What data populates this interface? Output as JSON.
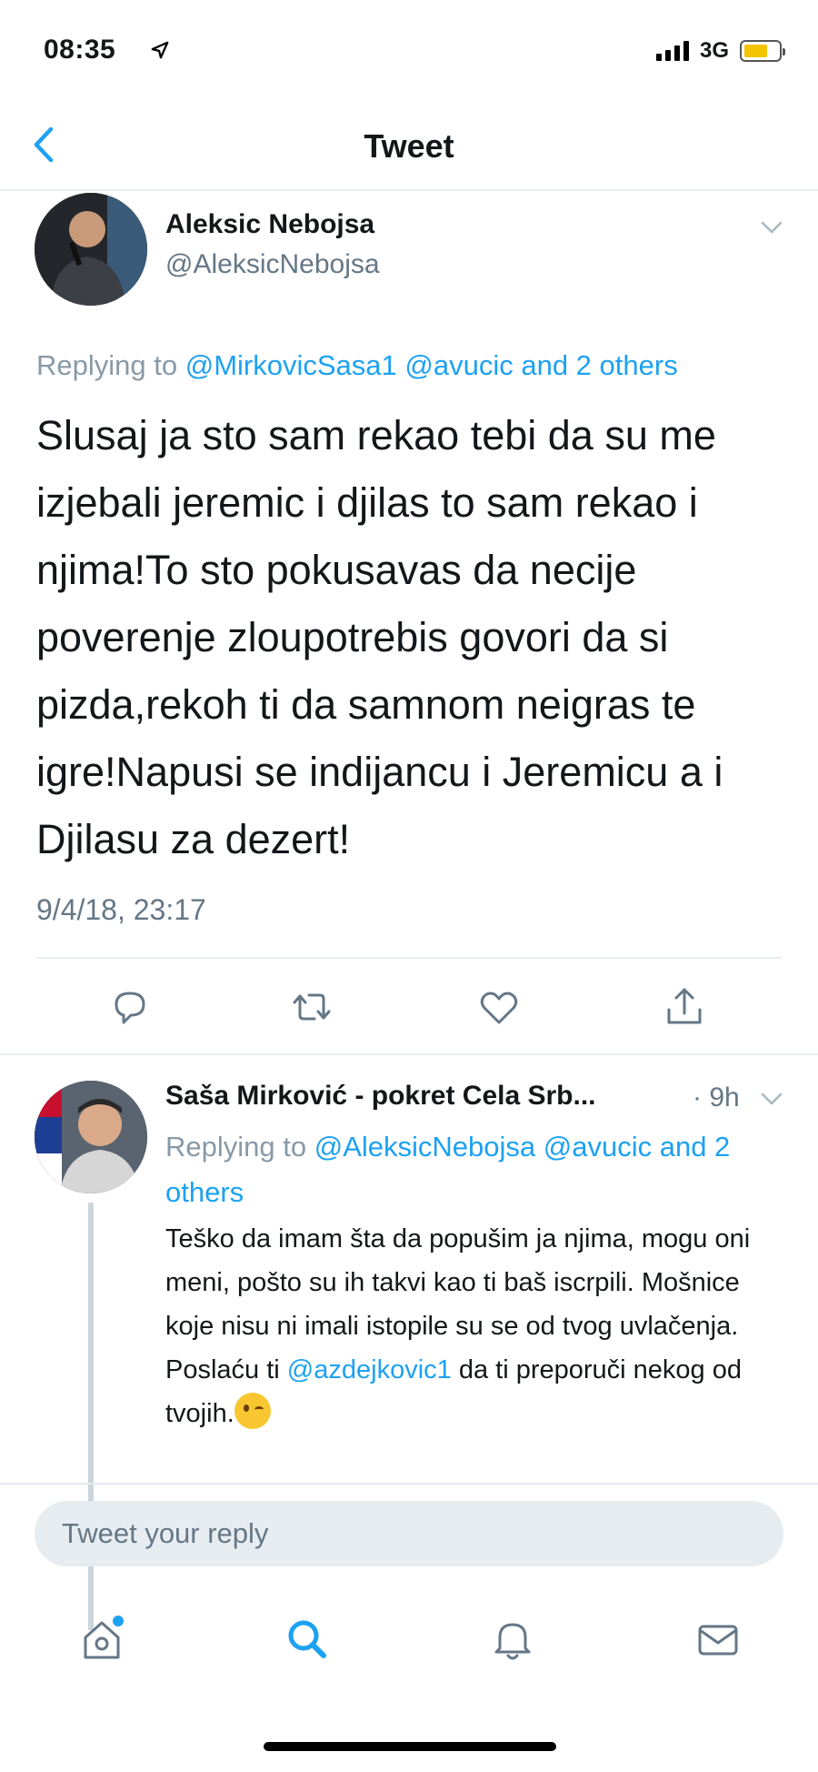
{
  "status_bar": {
    "time": "08:35",
    "network": "3G",
    "battery_level": 0.7,
    "battery_color": "#f5c400"
  },
  "nav": {
    "title": "Tweet",
    "back_icon": "chevron-left-icon"
  },
  "main_tweet": {
    "author_name": "Aleksic Nebojsa",
    "author_handle": "@AleksicNebojsa",
    "replying_prefix": "Replying to",
    "replying_mention_1": "@MirkovicSasa1",
    "replying_mention_2": "@avucic",
    "replying_suffix": "and 2 others",
    "text": "Slusaj ja sto sam rekao tebi da su me izjebali jeremic i djilas to sam rekao i njima!To sto pokusavas da necije poverenje zloupotrebis govori da si pizda,rekoh ti da samnom neigras te igre!Napusi se indijancu i Jeremicu a i Djilasu za dezert!",
    "timestamp": "9/4/18, 23:17",
    "actions": [
      "reply-icon",
      "retweet-icon",
      "like-icon",
      "share-icon"
    ]
  },
  "reply_tweet": {
    "author_name": "Saša Mirković - pokret Cela Srb...",
    "time_ago": "· 9h",
    "replying_prefix": "Replying to",
    "replying_mention_1": "@AleksicNebojsa",
    "replying_mention_2": "@avucic",
    "replying_suffix": "and 2 others",
    "text_part1": "Teško da imam šta da popušim ja njima, mogu oni meni, pošto su ih takvi kao ti baš iscrpili. Mošnice koje nisu ni imali istopile su se od tvog uvlačenja. Poslaću ti",
    "text_mention": "@azdejkovic1",
    "text_part2": "da ti preporuči nekog od tvojih."
  },
  "compose": {
    "placeholder": "Tweet your reply"
  },
  "tabbar": {
    "items": [
      "home-icon",
      "search-icon",
      "notifications-icon",
      "messages-icon"
    ],
    "active": "search-icon",
    "accent": "#1da1f2"
  },
  "colors": {
    "accent": "#1da1f2",
    "secondary_text": "#657786",
    "border": "#e6ecf0"
  }
}
